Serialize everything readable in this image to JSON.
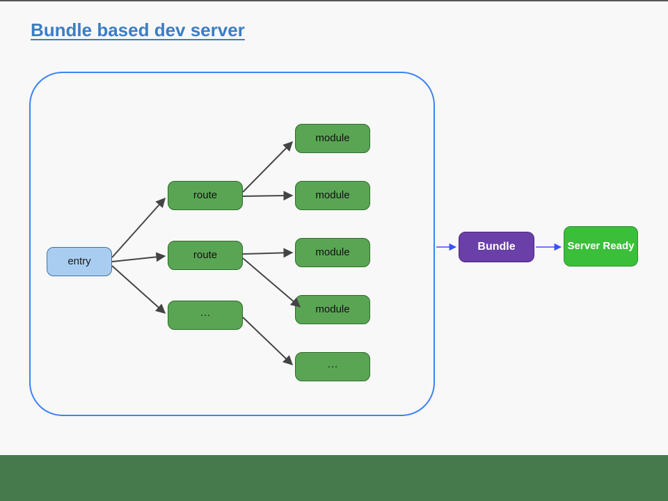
{
  "title": "Bundle based dev server",
  "nodes": {
    "entry": "entry",
    "route1": "route",
    "route2": "route",
    "route3": "···",
    "module1": "module",
    "module2": "module",
    "module3": "module",
    "module4": "module",
    "module5": "···",
    "bundle": "Bundle",
    "server": "Server Ready"
  },
  "colors": {
    "entry_bg": "#a9cdf0",
    "green_bg": "#5aa554",
    "purple_bg": "#6a3fa8",
    "server_bg": "#3bbf3b",
    "bubble_border": "#3b82f6",
    "title": "#3b7dc4",
    "arrow": "#444444",
    "arrow_blue": "#3b4fff",
    "footer": "#467a4c"
  }
}
